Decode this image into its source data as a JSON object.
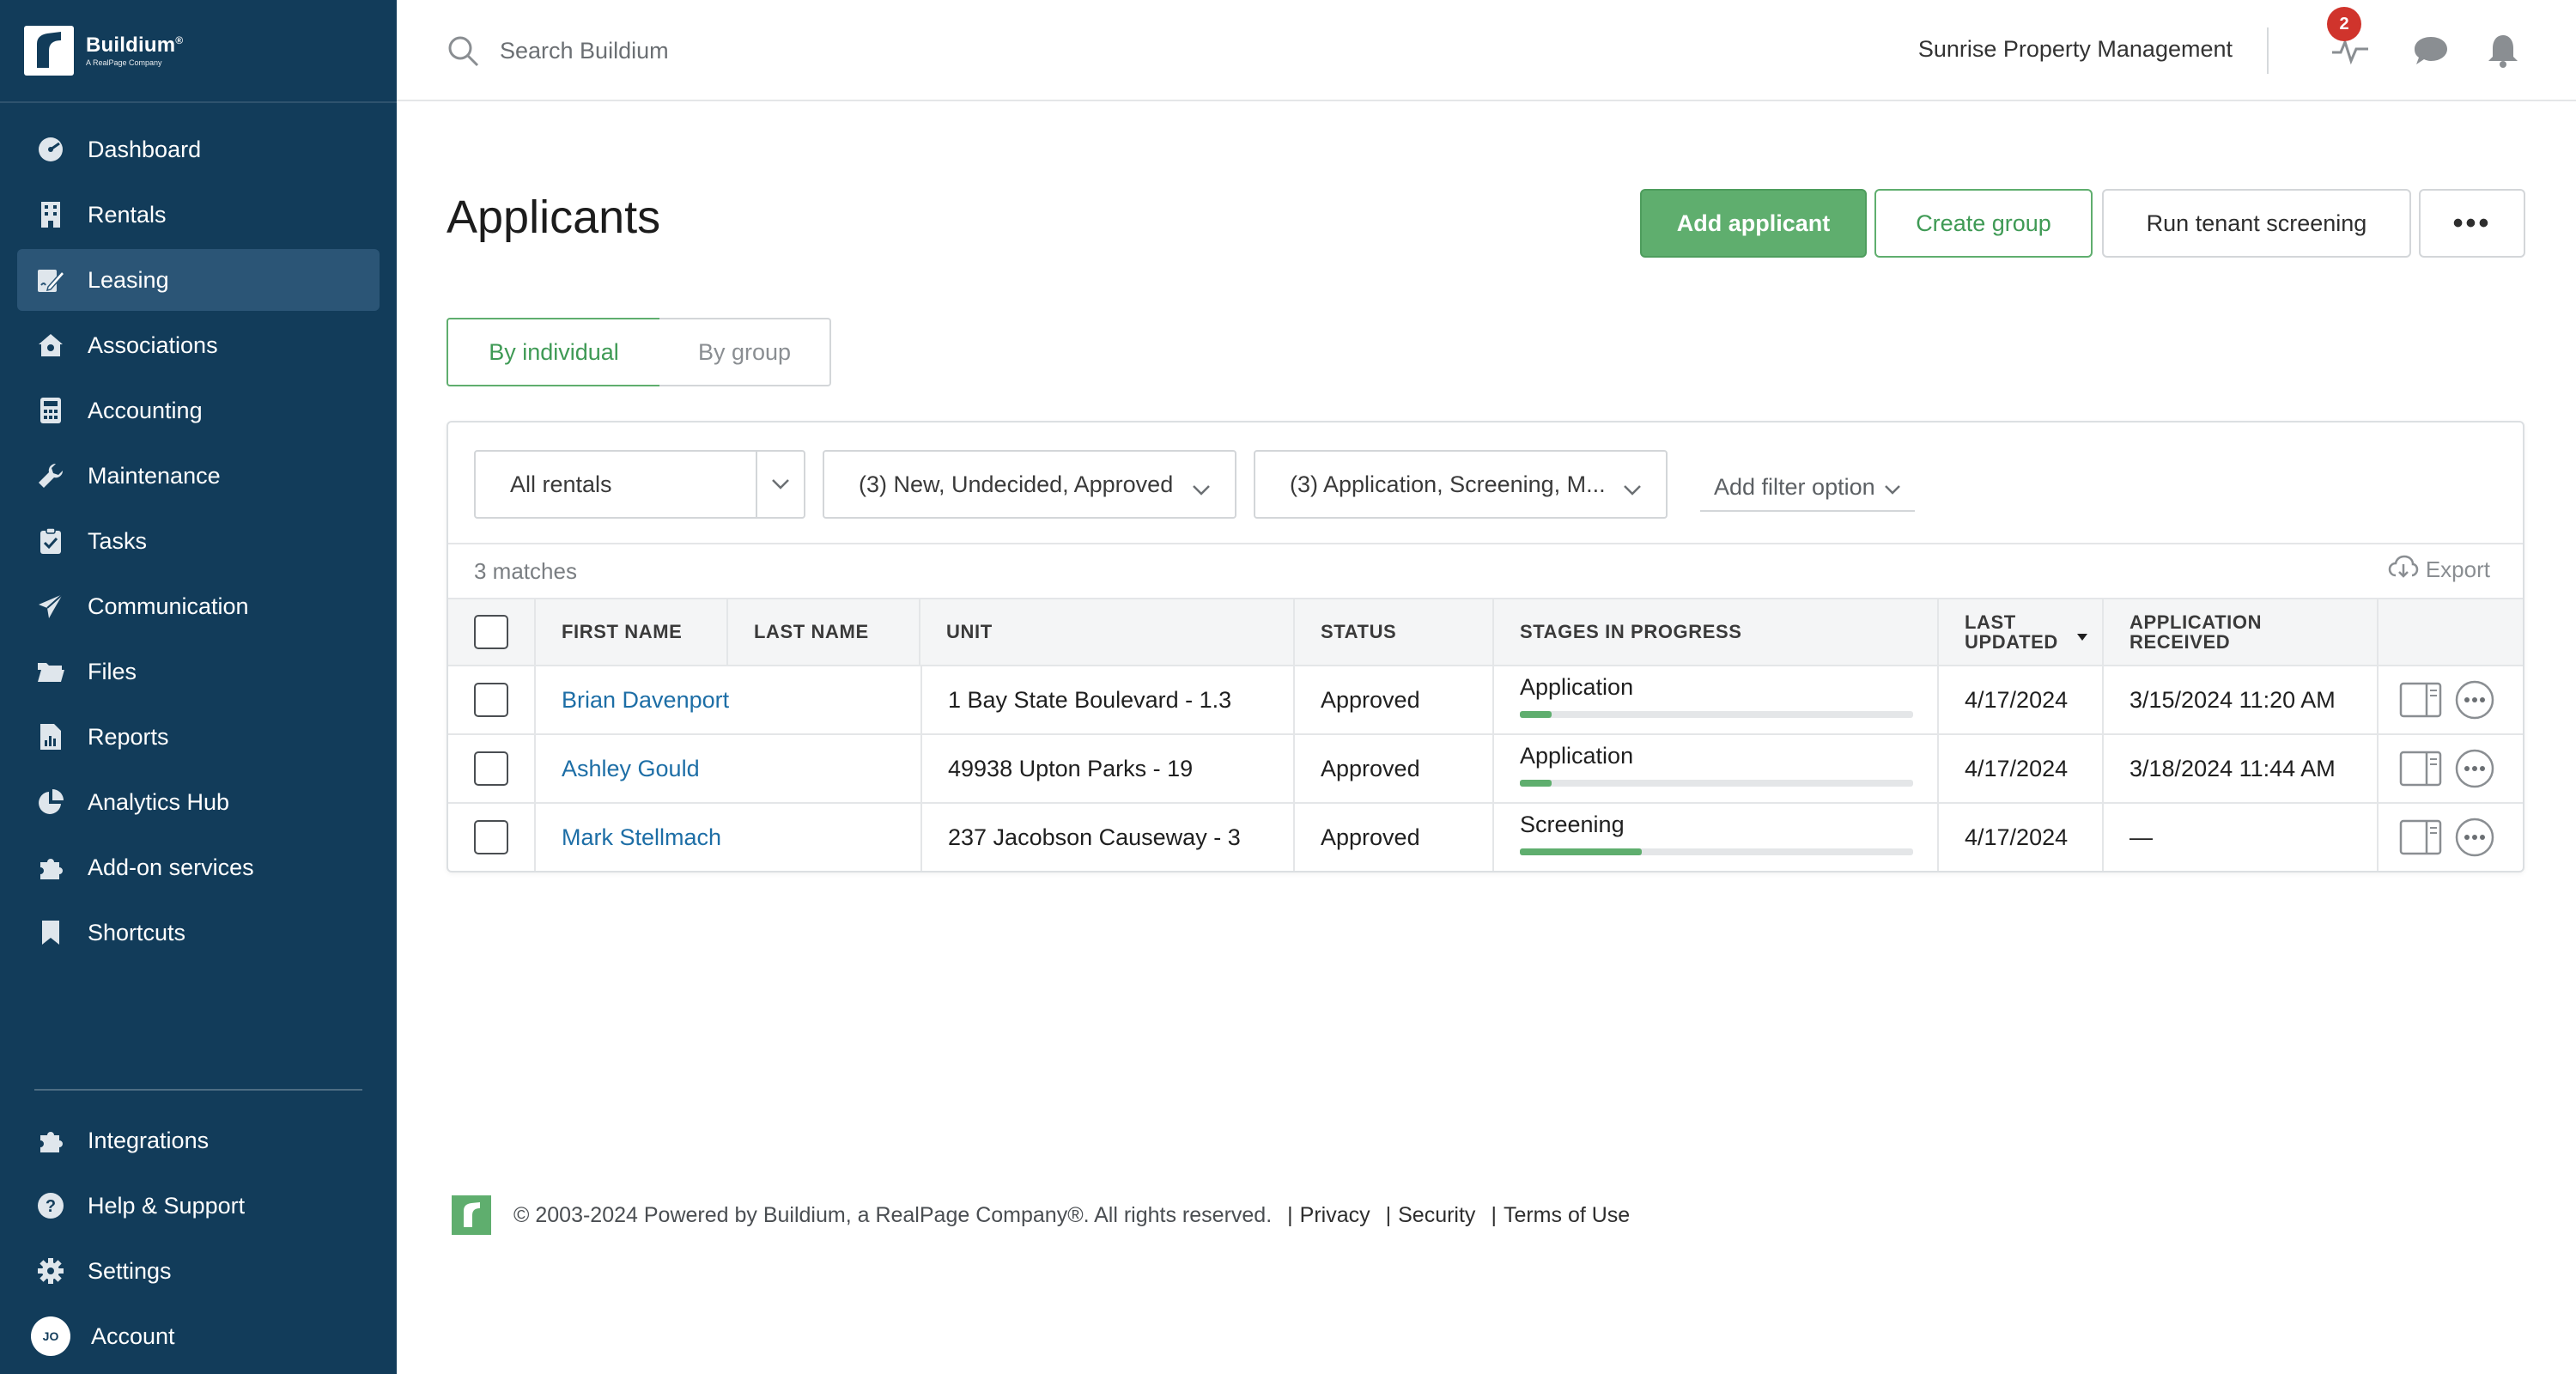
{
  "brand": {
    "name": "Buildium",
    "trademark": "®",
    "tagline": "A RealPage Company"
  },
  "sidebar": {
    "items": [
      {
        "label": "Dashboard",
        "icon": "dashboard-icon"
      },
      {
        "label": "Rentals",
        "icon": "building-icon"
      },
      {
        "label": "Leasing",
        "icon": "lease-sign-icon",
        "active": true
      },
      {
        "label": "Associations",
        "icon": "house-icon"
      },
      {
        "label": "Accounting",
        "icon": "calculator-icon"
      },
      {
        "label": "Maintenance",
        "icon": "wrench-icon"
      },
      {
        "label": "Tasks",
        "icon": "clipboard-check-icon"
      },
      {
        "label": "Communication",
        "icon": "paper-plane-icon"
      },
      {
        "label": "Files",
        "icon": "folder-icon"
      },
      {
        "label": "Reports",
        "icon": "report-icon"
      },
      {
        "label": "Analytics Hub",
        "icon": "pie-chart-icon"
      },
      {
        "label": "Add-on services",
        "icon": "puzzle-icon"
      },
      {
        "label": "Shortcuts",
        "icon": "bookmark-icon"
      }
    ],
    "bottom_items": [
      {
        "label": "Integrations",
        "icon": "puzzle-icon"
      },
      {
        "label": "Help & Support",
        "icon": "help-icon"
      },
      {
        "label": "Settings",
        "icon": "gear-icon"
      },
      {
        "label": "Account",
        "icon": "avatar",
        "initials": "JO"
      }
    ]
  },
  "topbar": {
    "search_placeholder": "Search Buildium",
    "company": "Sunrise Property Management",
    "activity_badge": "2"
  },
  "page": {
    "title": "Applicants",
    "buttons": {
      "add_applicant": "Add applicant",
      "create_group": "Create group",
      "run_screening": "Run tenant screening",
      "more": "•••"
    },
    "view_toggle": {
      "by_individual": "By individual",
      "by_group": "By group"
    },
    "filters": {
      "rentals": "All rentals",
      "status": "(3) New, Undecided, Approved",
      "stages": "(3) Application, Screening, M...",
      "add_filter": "Add filter option"
    },
    "matches": "3 matches",
    "export": "Export"
  },
  "table": {
    "columns": {
      "first_name": "FIRST NAME",
      "last_name": "LAST NAME",
      "unit": "UNIT",
      "status": "STATUS",
      "stages": "STAGES IN PROGRESS",
      "last_updated_1": "LAST",
      "last_updated_2": "UPDATED",
      "app_received_1": "APPLICATION",
      "app_received_2": "RECEIVED"
    },
    "rows": [
      {
        "first_name": "Brian Davenport",
        "last_name": "",
        "unit": "1 Bay State Boulevard - 1.3",
        "status": "Approved",
        "stage": "Application",
        "stage_progress": 0.08,
        "last_updated": "4/17/2024",
        "application_received": "3/15/2024 11:20 AM"
      },
      {
        "first_name": "Ashley Gould",
        "last_name": "",
        "unit": "49938 Upton Parks - 19",
        "status": "Approved",
        "stage": "Application",
        "stage_progress": 0.08,
        "last_updated": "4/17/2024",
        "application_received": "3/18/2024 11:44 AM"
      },
      {
        "first_name": "Mark Stellmach",
        "last_name": "",
        "unit": "237 Jacobson Causeway - 3",
        "status": "Approved",
        "stage": "Screening",
        "stage_progress": 0.31,
        "last_updated": "4/17/2024",
        "application_received": "—"
      }
    ]
  },
  "footer": {
    "copyright": "© 2003-2024 Powered by Buildium, a RealPage Company®. All rights reserved.",
    "links": {
      "privacy": "Privacy",
      "security": "Security",
      "terms": "Terms of Use"
    }
  },
  "colors": {
    "sidebar_bg": "#123c5a",
    "accent_green": "#5fae6e",
    "link_blue": "#1d6ea6",
    "badge_red": "#d0342c"
  }
}
